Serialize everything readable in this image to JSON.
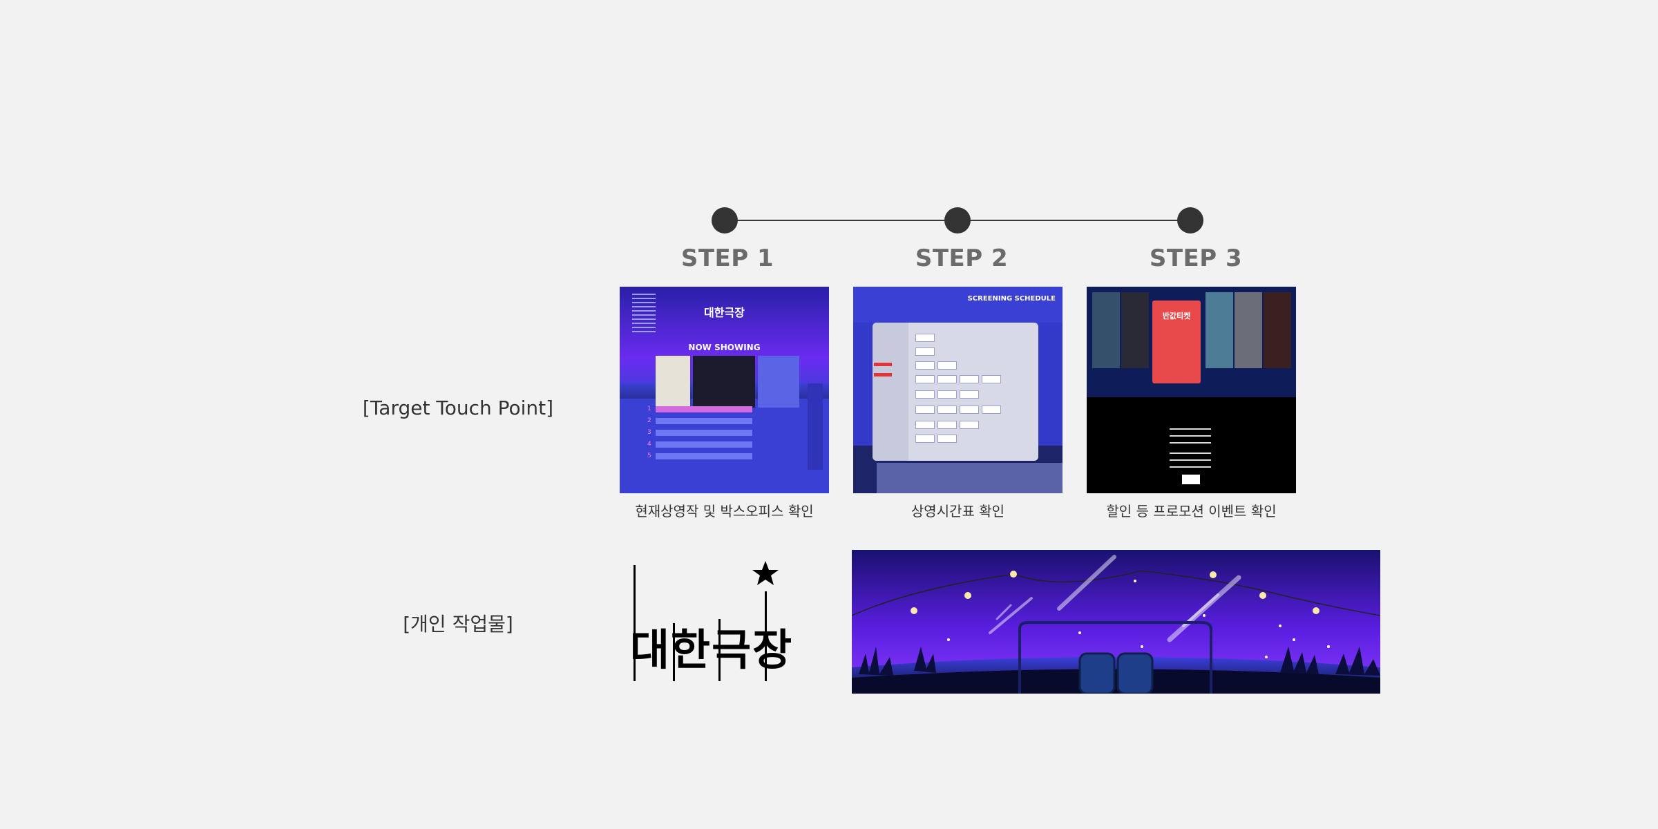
{
  "steps": [
    {
      "label": "STEP 1",
      "caption": "현재상영작 및 박스오피스 확인"
    },
    {
      "label": "STEP 2",
      "caption": "상영시간표 확인"
    },
    {
      "label": "STEP 3",
      "caption": "할인 등 프로모션 이벤트 확인"
    }
  ],
  "rows": {
    "touch_point": "[Target Touch Point]",
    "personal_work": "[개인 작업물]"
  },
  "thumbnails": {
    "step1": {
      "title": "대한극장",
      "heading": "NOW SHOWING",
      "ranks": [
        "1",
        "2",
        "3",
        "4",
        "5"
      ]
    },
    "step2": {
      "heading": "SCREENING SCHEDULE"
    },
    "step3": {
      "promo": "반값티켓"
    }
  },
  "logo": {
    "text": "대한극장",
    "icon": "star-icon"
  },
  "colors": {
    "background": "#f2f2f2",
    "step_label": "#6b6b6b",
    "timeline": "#333333",
    "brand_blue": "#3a40d4",
    "brand_purple": "#6a2cf0"
  }
}
